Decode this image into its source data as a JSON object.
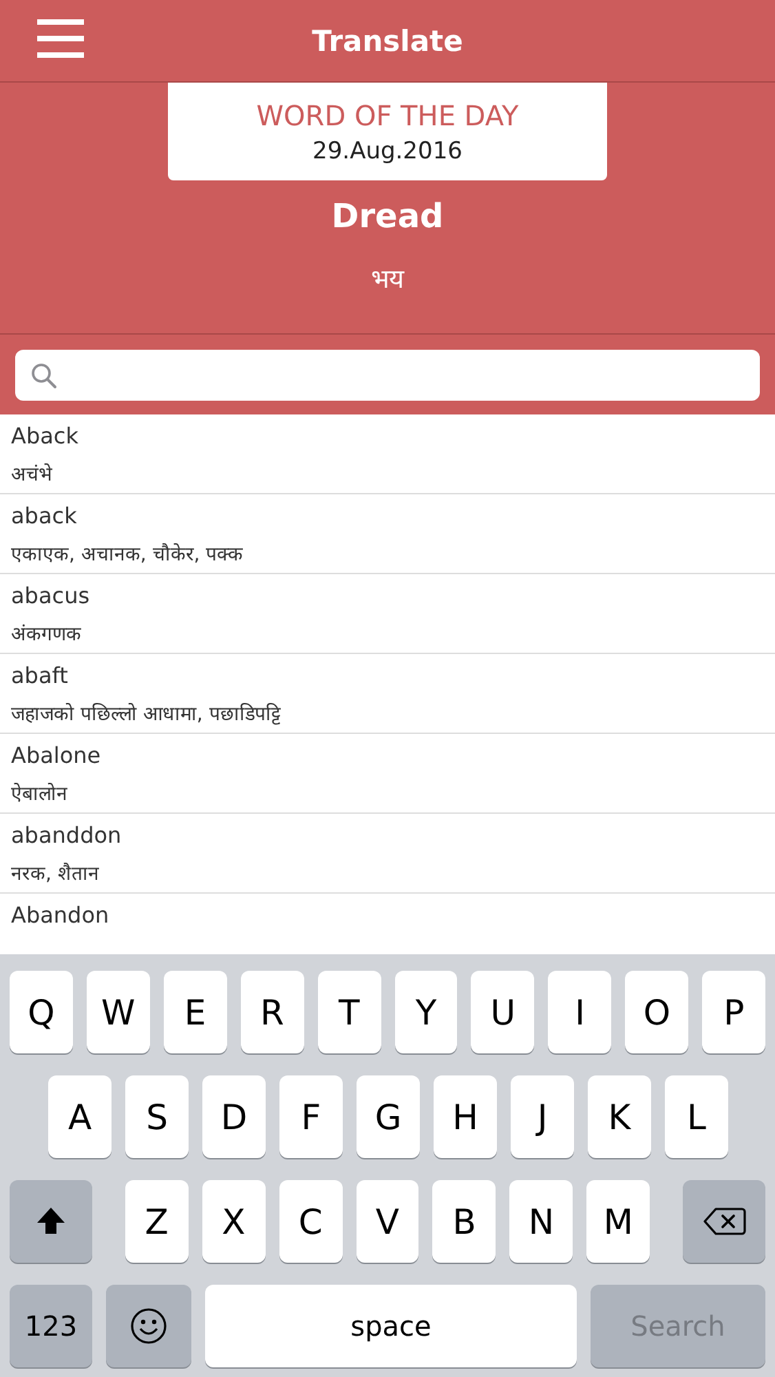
{
  "header": {
    "title": "Translate"
  },
  "word_of_day": {
    "heading": "WORD OF THE DAY",
    "date": "29.Aug.2016",
    "word": "Dread",
    "translation": "भय"
  },
  "entries": [
    {
      "word": "Aback",
      "translation": "अचंभे"
    },
    {
      "word": "aback",
      "translation": "एकाएक, अचानक, चौकेर, पक्क"
    },
    {
      "word": "abacus",
      "translation": "अंकगणक"
    },
    {
      "word": "abaft",
      "translation": "जहाजको पछिल्लो आधामा, पछाडिपट्टि"
    },
    {
      "word": "Abalone",
      "translation": "ऐबालोन"
    },
    {
      "word": "abanddon",
      "translation": "नरक, शैतान"
    },
    {
      "word": "Abandon"
    }
  ],
  "keyboard": {
    "letter_rows": [
      [
        "Q",
        "W",
        "E",
        "R",
        "T",
        "Y",
        "U",
        "I",
        "O",
        "P"
      ],
      [
        "A",
        "S",
        "D",
        "F",
        "G",
        "H",
        "J",
        "K",
        "L"
      ],
      [
        "Z",
        "X",
        "C",
        "V",
        "B",
        "N",
        "M"
      ]
    ],
    "mode_key": "123",
    "space_key": "space",
    "action_key": {
      "label": "Search",
      "disabled": true
    }
  }
}
